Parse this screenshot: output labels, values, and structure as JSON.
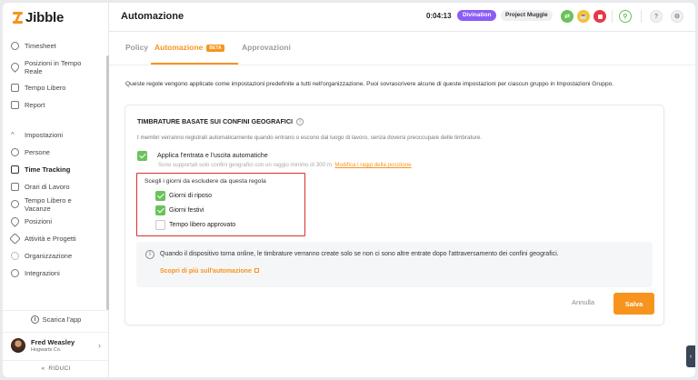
{
  "app": {
    "brand": "Jibble"
  },
  "sidebar": {
    "items": [
      {
        "label": "Timesheet",
        "icon": "clock-icon"
      },
      {
        "label": "Posizioni in Tempo Reale",
        "icon": "location-pin-icon"
      },
      {
        "label": "Tempo Libero",
        "icon": "calendar-icon"
      },
      {
        "label": "Report",
        "icon": "report-icon"
      }
    ],
    "settings_items": [
      {
        "label": "Impostazioni",
        "icon": "chevron-up-icon"
      },
      {
        "label": "Persone",
        "icon": "people-icon"
      },
      {
        "label": "Time Tracking",
        "icon": "time-tracking-icon",
        "active": true
      },
      {
        "label": "Orari di Lavoro",
        "icon": "schedule-icon"
      },
      {
        "label": "Tempo Libero e Vacanze",
        "icon": "holiday-icon"
      },
      {
        "label": "Posizioni",
        "icon": "location-pin-icon"
      },
      {
        "label": "Attività e Progetti",
        "icon": "tag-icon"
      },
      {
        "label": "Organizzazione",
        "icon": "gear-icon"
      },
      {
        "label": "Integrazioni",
        "icon": "plug-icon"
      }
    ],
    "download_label": "Scarica l'app",
    "user": {
      "name": "Fred Weasley",
      "org": "Hogwarts Co."
    },
    "collapse_label": "RIDUCI"
  },
  "header": {
    "title": "Automazione",
    "timer": "0:04:13",
    "org_badge": "Divination",
    "project_badge": "Project Muggle"
  },
  "tabs": [
    {
      "label": "Policy"
    },
    {
      "label": "Automazione",
      "badge": "BETA",
      "active": true
    },
    {
      "label": "Approvazioni"
    }
  ],
  "intro": "Queste regole vengono applicate come impostazioni predefinite a tutti nell'organizzazione. Puoi sovrascrivere alcune di queste impostazioni per ciascun gruppo in Impostazioni Gruppo.",
  "geo": {
    "title": "TIMBRATURE BASATE SUI CONFINI GEOGRAFICI",
    "description": "I membri verranno registrati automaticamente quando entrano o escono dal luogo di lavoro, senza doversi preoccupare delle timbrature.",
    "apply_label": "Applica l'entrata e l'uscita automatiche",
    "apply_checked": true,
    "apply_sub": "Sono supportati solo confini geografici con un raggio minimo di 300 m.",
    "apply_link": "Modifica i raggi della posizione",
    "exclude_title": "Scegli i giorni da escludere da questa regola",
    "exclude_options": [
      {
        "label": "Giorni di riposo",
        "checked": true
      },
      {
        "label": "Giorni festivi",
        "checked": true
      },
      {
        "label": "Tempo libero approvato",
        "checked": false
      }
    ],
    "note": "Quando il dispositivo torna online, le timbrature verranno create solo se non ci sono altre entrate dopo l'attraversamento dei confini geografici.",
    "note_link": "Scopri di più sull'automazione"
  },
  "actions": {
    "cancel": "Annulla",
    "save": "Salva"
  },
  "colors": {
    "accent": "#f7941d",
    "success": "#6ac259",
    "purple": "#8b5cf6",
    "danger": "#d9302f"
  }
}
